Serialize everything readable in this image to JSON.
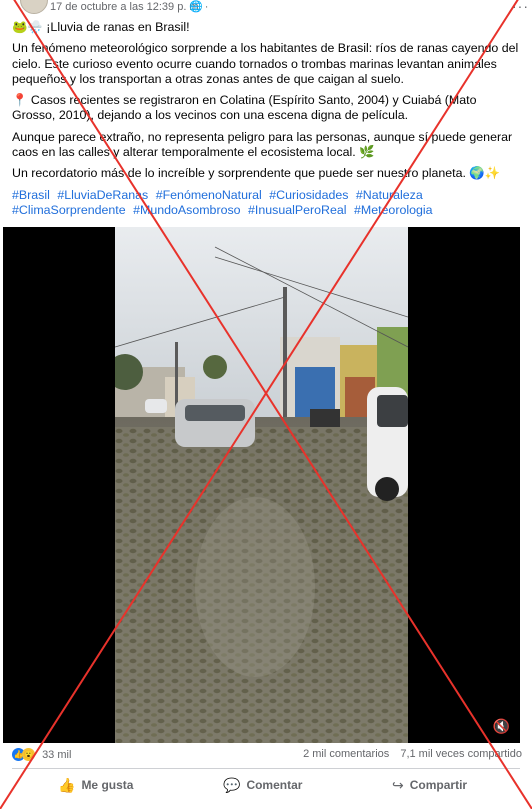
{
  "post": {
    "timestamp": "17 de octubre a las 12:39 p. m. ·",
    "more_label": "···",
    "title": "🐸🌧️ ¡Lluvia de ranas en Brasil!",
    "paragraphs": [
      "Un fenómeno meteorológico sorprende a los habitantes de Brasil: ríos de ranas cayendo del cielo. Este curioso evento ocurre cuando tornados o trombas marinas levantan animales pequeños y los transportan a otras zonas antes de que caigan al suelo.",
      "📍 Casos recientes se registraron en Colatina (Espírito Santo, 2004) y Cuiabá (Mato Grosso, 2010), dejando a los vecinos con una escena digna de película.",
      "Aunque parece extraño, no representa peligro para las personas, aunque sí puede generar caos en las calles y alterar temporalmente el ecosistema local. 🌿",
      "Un recordatorio más de lo increíble y sorprendente que puede ser nuestro planeta. 🌍✨"
    ],
    "hashtags": [
      "#Brasil",
      "#LluviaDeRanas",
      "#FenómenoNatural",
      "#Curiosidades",
      "#Naturaleza",
      "#ClimaSorprendente",
      "#MundoAsombroso",
      "#InusualPeroReal",
      "#Meteorologia"
    ]
  },
  "stats": {
    "reactions_count": "33 mil",
    "comments": "2 mil comentarios",
    "shares": "7,1 mil veces compartido"
  },
  "actions": {
    "like": "Me gusta",
    "comment": "Comentar",
    "share": "Compartir"
  },
  "colors": {
    "hashtag": "#216fdb",
    "cross": "#e8322b",
    "like_reaction": "#1877f2"
  }
}
